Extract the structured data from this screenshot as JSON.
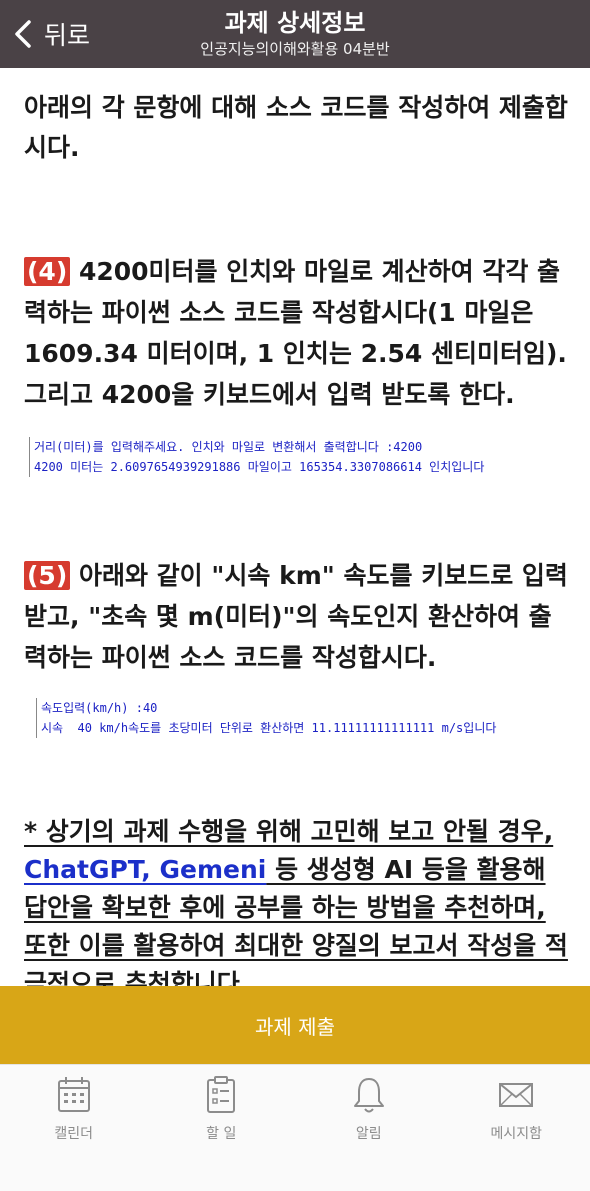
{
  "header": {
    "back_label": "뒤로",
    "title": "과제 상세정보",
    "subtitle": "인공지능의이해와활용 04분반"
  },
  "content": {
    "intro": "아래의 각 문항에 대해 소스 코드를 작성하여 제출합시다.",
    "q4": {
      "number": "(4)",
      "text": " 4200미터를 인치와 마일로 계산하여 각각 출력하는 파이썬 소스 코드를 작성합시다(1 마일은 1609.34 미터이며, 1 인치는 2.54 센티미터임). 그리고 4200을 키보드에서 입력 받도록 한다.",
      "code_lines": [
        "거리(미터)를 입력해주세요. 인치와 마일로 변환해서 출력합니다 :4200",
        "4200 미터는 2.6097654939291886 마일이고 165354.3307086614 인치입니다"
      ]
    },
    "q5": {
      "number": "(5)",
      "text": " 아래와 같이 \"시속 km\" 속도를 키보드로 입력 받고, \"초속 몇 m(미터)\"의 속도인지 환산하여 출력하는 파이썬  소스 코드를 작성합시다.",
      "code_lines": [
        "속도입력(km/h) :40",
        "시속  40 km/h속도를 초당미터 단위로 환산하면 11.11111111111111 m/s입니다"
      ]
    },
    "notice": {
      "part1": "* 상기의 과제 수행을 위해 고민해 보고 안될 경우, ",
      "link": "ChatGPT, Gemeni",
      "part2": " 등 생성형 AI 등을 활용해 답안을 확보한 후에 공부를 하는 방법을 추천하며, 또한 이를 활용하여 최대한 양질의 보고서 작성을 적극적으로 추천합니다",
      "end": "."
    }
  },
  "submit_label": "과제 제출",
  "tabbar": {
    "items": [
      {
        "label": "캘린더",
        "icon": "calendar-icon"
      },
      {
        "label": "할 일",
        "icon": "todo-clipboard-icon"
      },
      {
        "label": "알림",
        "icon": "bell-icon"
      },
      {
        "label": "메시지함",
        "icon": "envelope-icon"
      }
    ]
  },
  "colors": {
    "header_bg": "#4a4246",
    "submit_bg": "#d8a617",
    "question_number_bg": "#d63b2f",
    "code_text": "#1c22c4",
    "link": "#1b2fc9"
  }
}
